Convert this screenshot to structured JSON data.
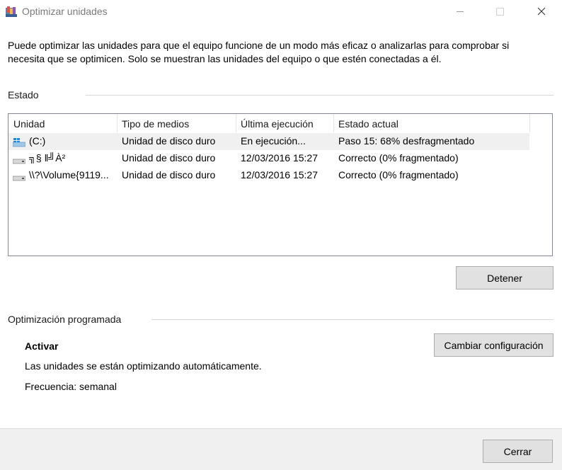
{
  "window": {
    "title": "Optimizar unidades"
  },
  "intro_text": "Puede optimizar las unidades para que el equipo funcione de un modo más eficaz o analizarlas para comprobar si necesita que se optimicen. Solo se muestran las unidades del equipo o que estén conectadas a él.",
  "status_section": {
    "title": "Estado",
    "columns": [
      "Unidad",
      "Tipo de medios",
      "Última ejecución",
      "Estado actual"
    ],
    "rows": [
      {
        "unit": "(C:)",
        "media_type": "Unidad de disco duro",
        "last_run": "En ejecución...",
        "status": "Paso 15: 68% desfragmentado",
        "icon": "windows-drive-icon",
        "selected": true
      },
      {
        "unit": "╗§ ‖╝À²",
        "media_type": "Unidad de disco duro",
        "last_run": "12/03/2016 15:27",
        "status": "Correcto (0% fragmentado)",
        "icon": "hard-drive-icon",
        "selected": false
      },
      {
        "unit": "\\\\?\\Volume{9119...",
        "media_type": "Unidad de disco duro",
        "last_run": "12/03/2016 15:27",
        "status": "Correcto (0% fragmentado)",
        "icon": "hard-drive-icon",
        "selected": false
      }
    ],
    "stop_button": "Detener"
  },
  "schedule_section": {
    "title": "Optimización programada",
    "state_label": "Activar",
    "description": "Las unidades se están optimizando automáticamente.",
    "frequency": "Frecuencia: semanal",
    "change_button": "Cambiar configuración"
  },
  "footer": {
    "close_button": "Cerrar"
  },
  "colors": {
    "button_bg": "#e1e1e1",
    "button_border": "#adadad",
    "selected_row": "#f0f0f0",
    "footer_bg": "#f0f0f0",
    "title_text": "#7a7a7a"
  }
}
